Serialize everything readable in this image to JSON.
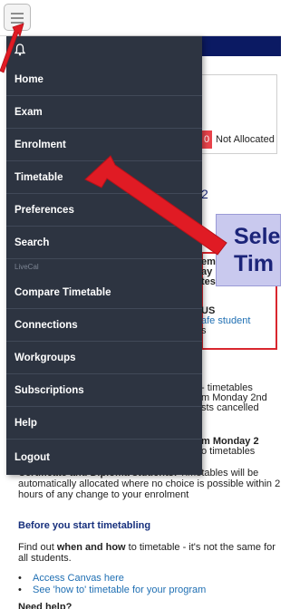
{
  "menu": {
    "group_label": "LiveCal",
    "items": [
      "Home",
      "Exam",
      "Enrolment",
      "Timetable",
      "Preferences",
      "Search",
      "Compare Timetable",
      "Connections",
      "Workgroups",
      "Subscriptions",
      "Help",
      "Logout"
    ]
  },
  "callout": {
    "text": "Sele\nTim"
  },
  "background": {
    "alloc_count": "0",
    "alloc_label": "Not Allocated",
    "section_number": "2",
    "redbox_lines": [
      "em",
      "ay",
      "tes"
    ],
    "redbox_status": "US",
    "redbox_link": "afe student",
    "redbox_tail": "s",
    "para1_a": "- timetables",
    "para1_b": "m Monday 2nd",
    "para1_c": "sts cancelled",
    "para2_a": "m Monday 2",
    "para2_b": "o timetables"
  },
  "bottom": {
    "certificate_bold": "Certificate and Diploma students:",
    "certificate_rest": " Timetables will be automatically allocated where no choice is possible within 2 hours of any change to your enrolment",
    "before_heading": "Before you start timetabling",
    "find_out_prefix": "Find out ",
    "find_out_bold": "when and how",
    "find_out_suffix": " to timetable - it's not the same for all students.",
    "links": [
      "Access Canvas here",
      "See 'how to' timetable for your program"
    ],
    "cutoff_heading": "Need help?"
  },
  "colors": {
    "sidebar_bg": "#2d3441",
    "accent_red": "#e01b24",
    "callout_bg": "#c9c9ee",
    "navy": "#0b1a63"
  }
}
